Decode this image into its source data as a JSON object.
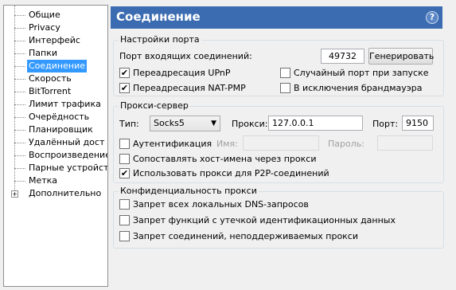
{
  "sidebar": {
    "items": [
      {
        "label": "Общие"
      },
      {
        "label": "Privacy"
      },
      {
        "label": "Интерфейс"
      },
      {
        "label": "Папки"
      },
      {
        "label": "Соединение"
      },
      {
        "label": "Скорость"
      },
      {
        "label": "BitTorrent"
      },
      {
        "label": "Лимит трафика"
      },
      {
        "label": "Очерёдность"
      },
      {
        "label": "Планировщик"
      },
      {
        "label": "Удалённый дост"
      },
      {
        "label": "Воспроизведение"
      },
      {
        "label": "Парные устройст"
      },
      {
        "label": "Метка"
      },
      {
        "label": "Дополнительно"
      }
    ],
    "expander": "+"
  },
  "header": {
    "title": "Соединение",
    "help": "?"
  },
  "port_group": {
    "title": "Настройки порта",
    "incoming_label": "Порт входящих соединений:",
    "port_value": "49732",
    "generate_button": "Генерировать",
    "upnp_label": "Переадресация UPnP",
    "upnp_checked": "✔",
    "natpmp_label": "Переадресация NAT-PMP",
    "natpmp_checked": "✔",
    "random_port_label": "Случайный порт при запуске",
    "firewall_label": "В исключения брандмауэра"
  },
  "proxy_group": {
    "title": "Прокси-сервер",
    "type_label": "Тип:",
    "type_value": "Socks5",
    "proxy_label": "Прокси:",
    "proxy_value": "127.0.0.1",
    "port_label": "Порт:",
    "port_value": "9150",
    "auth_label": "Аутентификация",
    "username_label": "Имя:",
    "password_label": "Пароль:",
    "resolve_label": "Сопоставлять хост-имена через прокси",
    "p2p_label": "Использовать прокси для P2P-соединений",
    "p2p_checked": "✔"
  },
  "privacy_group": {
    "title": "Конфиденциальность прокси",
    "dns_label": "Запрет всех локальных DNS-запросов",
    "leak_label": "Запрет функций с утечкой идентификационных данных",
    "unsupported_label": "Запрет соединений, неподдерживаемых прокси"
  }
}
